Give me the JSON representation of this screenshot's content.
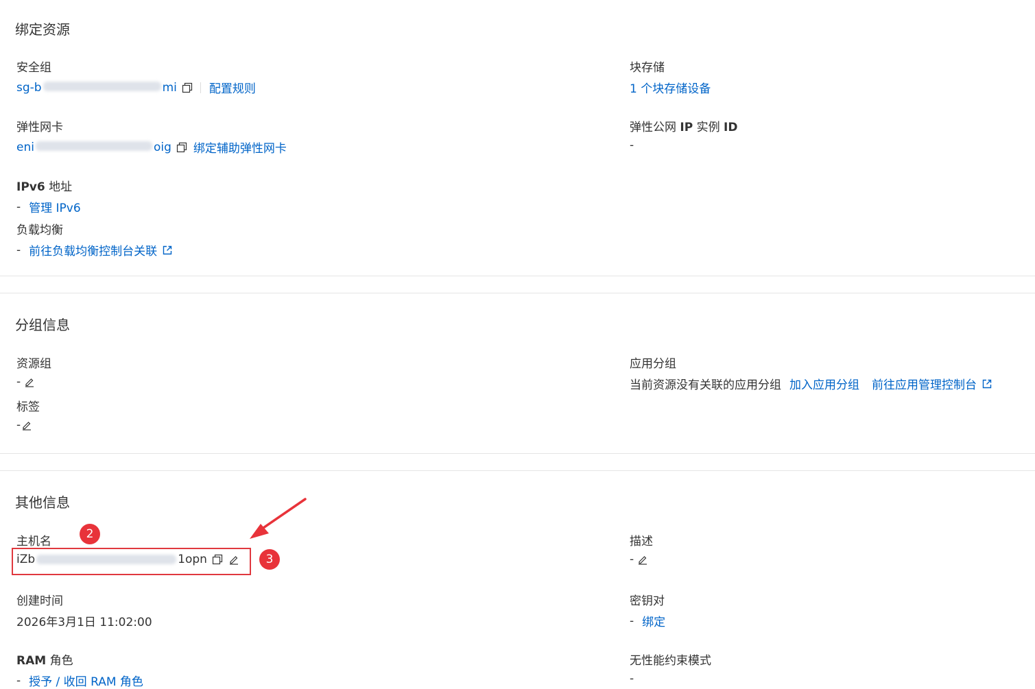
{
  "bound_resources": {
    "title": "绑定资源",
    "security_group": {
      "label": "安全组",
      "value_prefix": "sg-b",
      "value_suffix": "mi",
      "action": "配置规则"
    },
    "block_storage": {
      "label": "块存储",
      "value": "1 个块存储设备"
    },
    "eni": {
      "label": "弹性网卡",
      "value_prefix": "eni",
      "value_suffix": "oig",
      "action": "绑定辅助弹性网卡"
    },
    "eip": {
      "label_prefix": "弹性公网",
      "label_bold": "IP",
      "label_suffix": "实例",
      "label_id": "ID",
      "value": "-"
    },
    "ipv6": {
      "label_bold": "IPv6",
      "label_suffix": "地址",
      "value": "-",
      "action": "管理 IPv6"
    },
    "slb": {
      "label": "负载均衡",
      "value": "-",
      "action": "前往负载均衡控制台关联"
    }
  },
  "group_info": {
    "title": "分组信息",
    "resource_group": {
      "label": "资源组",
      "value": "-"
    },
    "app_group": {
      "label": "应用分组",
      "value": "当前资源没有关联的应用分组",
      "action1": "加入应用分组",
      "action2": "前往应用管理控制台"
    },
    "tags": {
      "label": "标签",
      "value": "-"
    }
  },
  "other_info": {
    "title": "其他信息",
    "hostname": {
      "label": "主机名",
      "value_prefix": "iZb",
      "value_suffix": "1opn"
    },
    "description": {
      "label": "描述",
      "value": "-"
    },
    "created_time": {
      "label": "创建时间",
      "value": "2026年3月1日 11:02:00"
    },
    "key_pair": {
      "label": "密钥对",
      "value": "-",
      "action": "绑定"
    },
    "ram_role": {
      "label_bold": "RAM",
      "label_suffix": "角色",
      "value": "-",
      "action": "授予 / 收回 RAM 角色"
    },
    "no_perf_mode": {
      "label": "无性能约束模式",
      "value": "-"
    }
  },
  "annotations": {
    "badge2": "2",
    "badge3": "3",
    "highlight_color": "#e0383e"
  },
  "colors": {
    "link": "#0064c8",
    "text": "#333333",
    "divider": "#e5e5e5"
  }
}
